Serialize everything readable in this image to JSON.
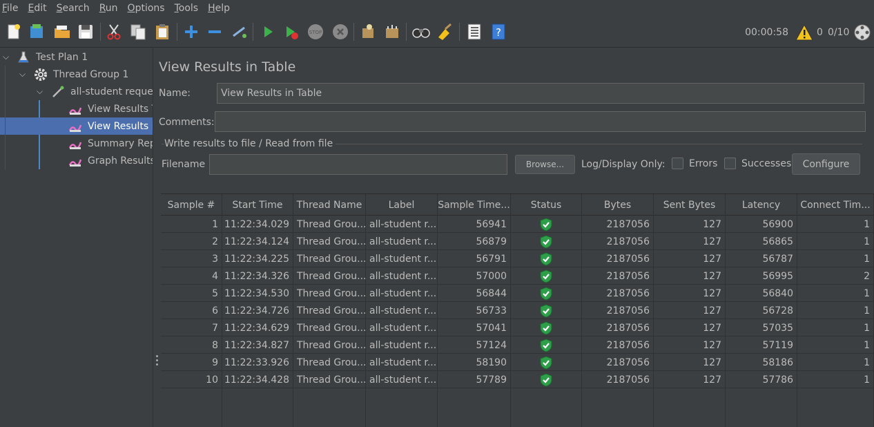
{
  "menu": [
    "File",
    "Edit",
    "Search",
    "Run",
    "Options",
    "Tools",
    "Help"
  ],
  "toolbar": {
    "timer": "00:00:58",
    "warnings": "0",
    "threads": "0/10",
    "icons": [
      "new-icon",
      "templates-icon",
      "open-icon",
      "save-icon",
      "cut-icon",
      "copy-icon",
      "paste-icon",
      "expand-icon",
      "collapse-icon",
      "toggle-icon",
      "start-icon",
      "start-no-pause-icon",
      "stop-icon",
      "shutdown-icon",
      "clear-icon",
      "clear-all-icon",
      "search-icon",
      "reset-search-icon",
      "function-helper-icon",
      "help-icon"
    ]
  },
  "tree": {
    "test_plan": "Test Plan 1",
    "thread_group": "Thread Group 1",
    "sampler": "all-student reques",
    "listeners": [
      "View Results T",
      "View Results in",
      "Summary Repo",
      "Graph Results"
    ]
  },
  "panel": {
    "title": "View Results in Table",
    "name_label": "Name:",
    "name_value": "View Results in Table",
    "comments_label": "Comments:",
    "comments_value": "",
    "group_title": "Write results to file / Read from file",
    "filename_label": "Filename",
    "filename_value": "",
    "browse_label": "Browse...",
    "log_display_label": "Log/Display Only:",
    "errors_label": "Errors",
    "successes_label": "Successes",
    "configure_label": "Configure"
  },
  "table": {
    "headers": [
      "Sample #",
      "Start Time",
      "Thread Name",
      "Label",
      "Sample Time...",
      "Status",
      "Bytes",
      "Sent Bytes",
      "Latency",
      "Connect Tim..."
    ],
    "rows": [
      [
        "1",
        "11:22:34.029",
        "Thread Grou...",
        "all-student r...",
        "56941",
        "success",
        "2187056",
        "127",
        "56900",
        "1"
      ],
      [
        "2",
        "11:22:34.124",
        "Thread Grou...",
        "all-student r...",
        "56879",
        "success",
        "2187056",
        "127",
        "56865",
        "1"
      ],
      [
        "3",
        "11:22:34.225",
        "Thread Grou...",
        "all-student r...",
        "56791",
        "success",
        "2187056",
        "127",
        "56787",
        "1"
      ],
      [
        "4",
        "11:22:34.326",
        "Thread Grou...",
        "all-student r...",
        "57000",
        "success",
        "2187056",
        "127",
        "56995",
        "2"
      ],
      [
        "5",
        "11:22:34.530",
        "Thread Grou...",
        "all-student r...",
        "56844",
        "success",
        "2187056",
        "127",
        "56840",
        "1"
      ],
      [
        "6",
        "11:22:34.726",
        "Thread Grou...",
        "all-student r...",
        "56733",
        "success",
        "2187056",
        "127",
        "56728",
        "1"
      ],
      [
        "7",
        "11:22:34.629",
        "Thread Grou...",
        "all-student r...",
        "57041",
        "success",
        "2187056",
        "127",
        "57035",
        "1"
      ],
      [
        "8",
        "11:22:34.827",
        "Thread Grou...",
        "all-student r...",
        "57124",
        "success",
        "2187056",
        "127",
        "57119",
        "1"
      ],
      [
        "9",
        "11:22:33.926",
        "Thread Grou...",
        "all-student r...",
        "58190",
        "success",
        "2187056",
        "127",
        "58186",
        "1"
      ],
      [
        "10",
        "11:22:34.428",
        "Thread Grou...",
        "all-student r...",
        "57789",
        "success",
        "2187056",
        "127",
        "57786",
        "1"
      ]
    ]
  },
  "colors": {
    "background": "#3c3f41",
    "selection": "#4b6eaf",
    "status_ok": "#2e9e4a",
    "text": "#bbbbbb"
  }
}
